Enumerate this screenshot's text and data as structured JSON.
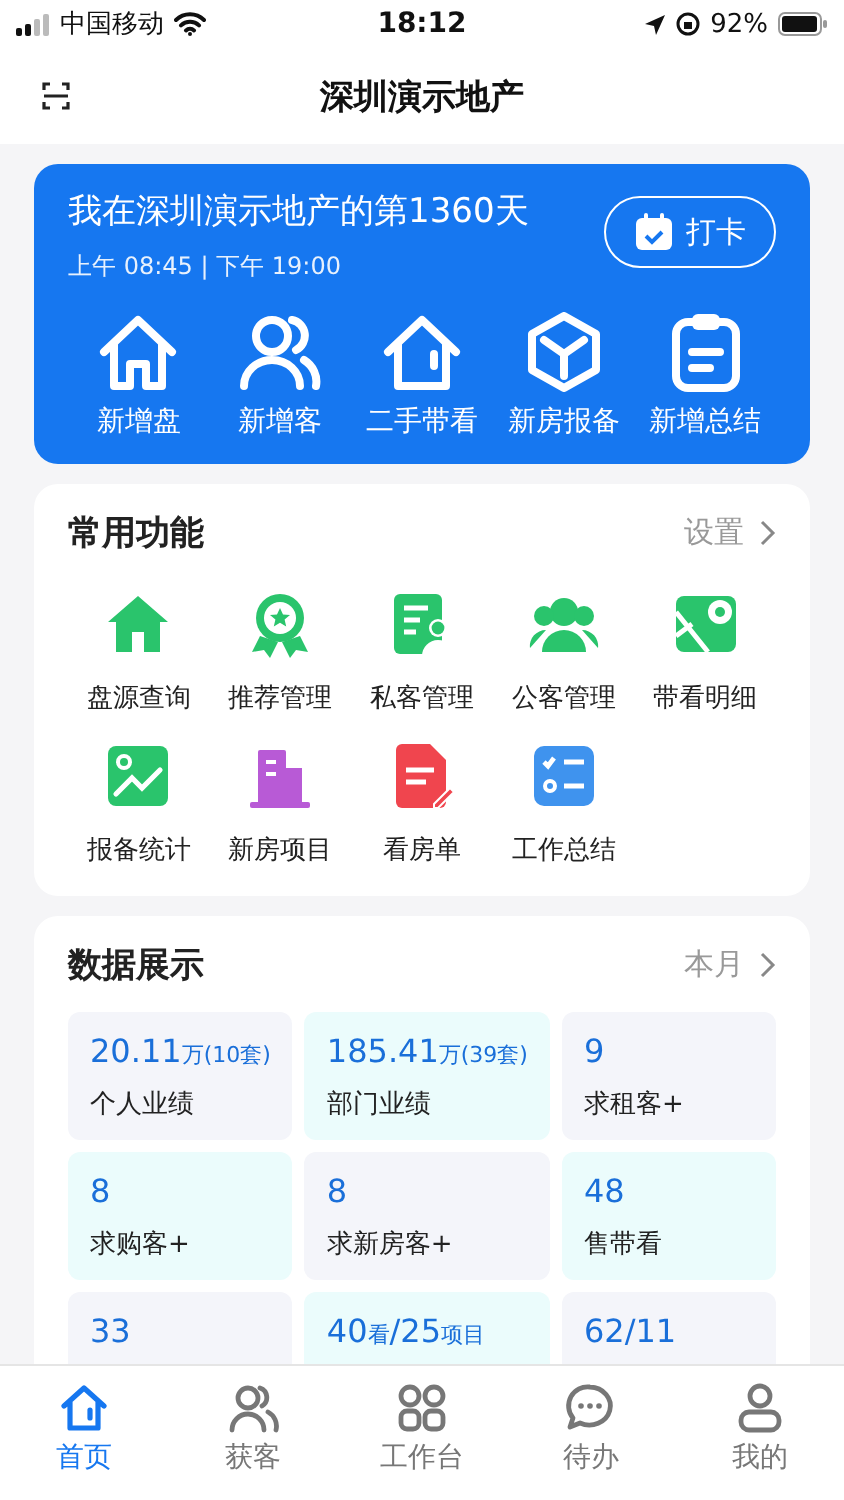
{
  "status_bar": {
    "carrier": "中国移动",
    "time": "18:12",
    "battery": "92%"
  },
  "nav": {
    "title": "深圳演示地产"
  },
  "banner": {
    "title": "我在深圳演示地产的第1360天",
    "hours": "上午 08:45 | 下午 19:00",
    "checkin_button": "打卡",
    "actions": [
      {
        "label": "新增盘"
      },
      {
        "label": "新增客"
      },
      {
        "label": "二手带看"
      },
      {
        "label": "新房报备"
      },
      {
        "label": "新增总结"
      }
    ]
  },
  "functions": {
    "title": "常用功能",
    "link": "设置",
    "items": [
      {
        "label": "盘源查询"
      },
      {
        "label": "推荐管理"
      },
      {
        "label": "私客管理"
      },
      {
        "label": "公客管理"
      },
      {
        "label": "带看明细"
      },
      {
        "label": "报备统计"
      },
      {
        "label": "新房项目"
      },
      {
        "label": "看房单"
      },
      {
        "label": "工作总结"
      }
    ]
  },
  "stats": {
    "title": "数据展示",
    "link": "本月",
    "tiles": [
      {
        "value": [
          {
            "text": "20.11",
            "small": false
          },
          {
            "text": "万(10套)",
            "small": true
          }
        ],
        "label": "个人业绩"
      },
      {
        "value": [
          {
            "text": "185.41",
            "small": false
          },
          {
            "text": "万(39套)",
            "small": true
          }
        ],
        "label": "部门业绩"
      },
      {
        "value": [
          {
            "text": "9",
            "small": false
          }
        ],
        "label": "求租客+"
      },
      {
        "value": [
          {
            "text": "8",
            "small": false
          }
        ],
        "label": "求购客+"
      },
      {
        "value": [
          {
            "text": "8",
            "small": false
          }
        ],
        "label": "求新房客+"
      },
      {
        "value": [
          {
            "text": "48",
            "small": false
          }
        ],
        "label": "售带看"
      },
      {
        "value": [
          {
            "text": "33",
            "small": false
          }
        ]
      },
      {
        "value": [
          {
            "text": "40",
            "small": false
          },
          {
            "text": "看",
            "small": true
          },
          {
            "text": "/25",
            "small": false
          },
          {
            "text": "项目",
            "small": true
          }
        ]
      },
      {
        "value": [
          {
            "text": "62/11",
            "small": false
          }
        ]
      }
    ]
  },
  "tab_bar": [
    {
      "label": "首页",
      "selected": true
    },
    {
      "label": "获客",
      "selected": false
    },
    {
      "label": "工作台",
      "selected": false
    },
    {
      "label": "待办",
      "selected": false
    },
    {
      "label": "我的",
      "selected": false
    }
  ]
}
